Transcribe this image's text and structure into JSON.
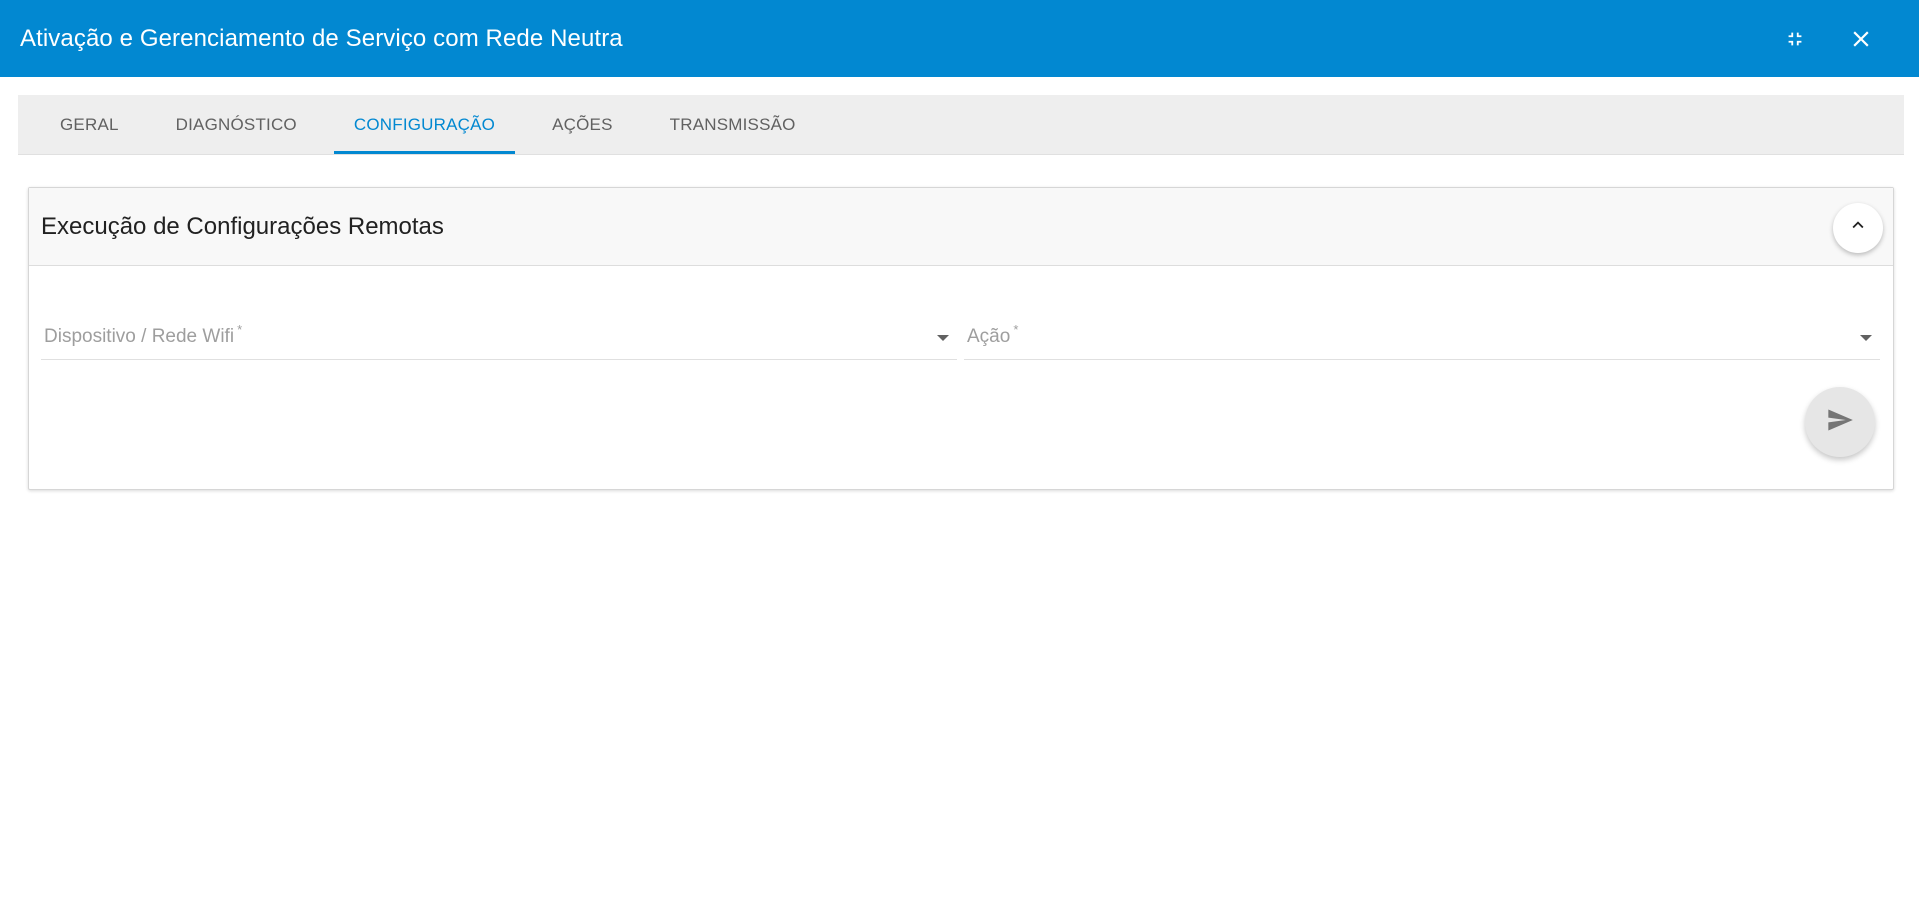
{
  "header": {
    "title": "Ativação e Gerenciamento de Serviço com Rede Neutra",
    "background": "#0288d1",
    "icons": {
      "minimize": "fullscreen-exit-icon",
      "close": "close-icon"
    }
  },
  "tabs": [
    {
      "label": "GERAL",
      "active": false
    },
    {
      "label": "DIAGNÓSTICO",
      "active": false
    },
    {
      "label": "CONFIGURAÇÃO",
      "active": true
    },
    {
      "label": "AÇÕES",
      "active": false
    },
    {
      "label": "TRANSMISSÃO",
      "active": false
    }
  ],
  "card": {
    "title": "Execução de Configurações Remotas",
    "collapse_icon": "chevron-up-icon",
    "fields": {
      "device": {
        "label": "Dispositivo / Rede Wifi",
        "required_mark": "*",
        "value": ""
      },
      "action": {
        "label": "Ação",
        "required_mark": "*",
        "value": ""
      }
    },
    "send_icon": "send-icon"
  },
  "colors": {
    "accent": "#0288d1",
    "tab_bar": "#eeeeee",
    "muted_text": "#9e9e9e"
  }
}
